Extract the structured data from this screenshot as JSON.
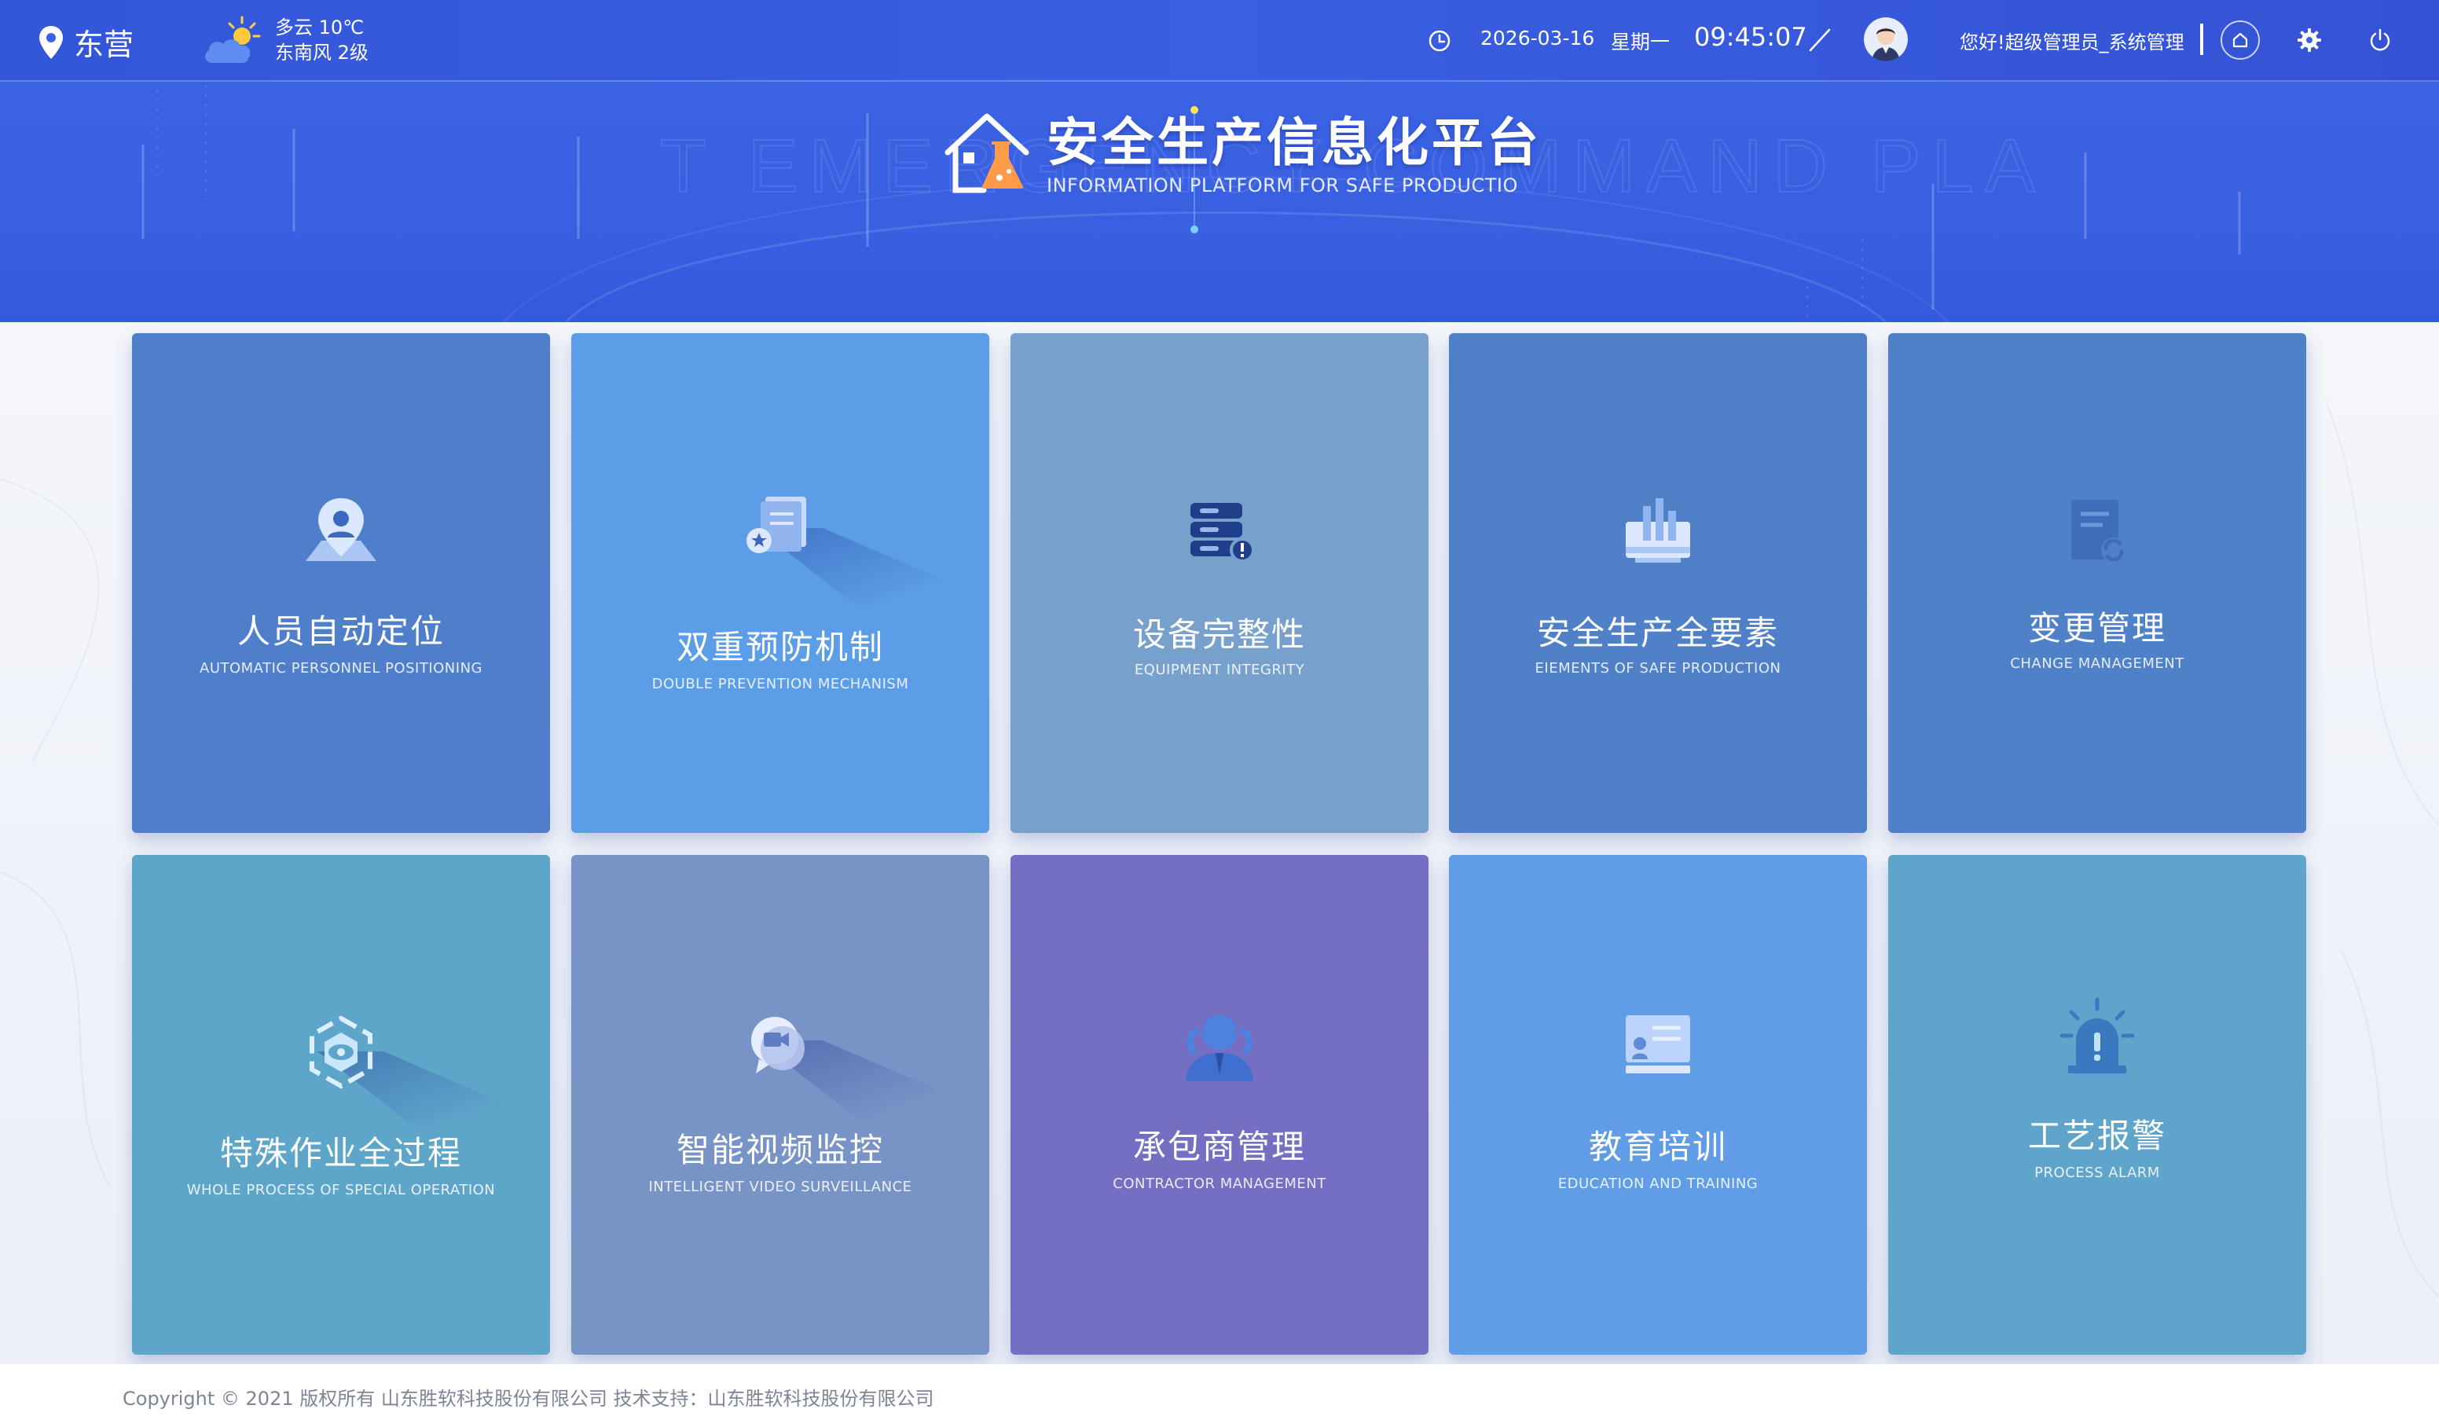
{
  "header": {
    "city": "东营",
    "weather": {
      "condition_temp": "多云 10℃",
      "wind": "东南风 2级"
    },
    "date": "2026-03-16",
    "weekday": "星期一",
    "time": "09:45:07",
    "greeting": "您好!超级管理员_系统管理",
    "icons": {
      "location": "location-pin-icon",
      "weather": "cloud-sun-icon",
      "clock": "clock-icon",
      "slash": "slash-icon",
      "home": "home-icon",
      "settings": "gear-icon",
      "power": "power-icon"
    }
  },
  "banner": {
    "title": "安全生产信息化平台",
    "subtitle": "INFORMATION PLATFORM FOR SAFE PRODUCTIO",
    "bg_watermark": "T EMERGENCY COMMAND PLA"
  },
  "modules": [
    {
      "title": "人员自动定位",
      "subtitle": "AUTOMATIC PERSONNEL POSITIONING",
      "icon": "map-pin-person-icon",
      "color": "#4f7fca"
    },
    {
      "title": "双重预防机制",
      "subtitle": "DOUBLE PREVENTION MECHANISM",
      "icon": "document-star-icon",
      "color": "#5b9de6"
    },
    {
      "title": "设备完整性",
      "subtitle": "EQUIPMENT INTEGRITY",
      "icon": "server-alert-icon",
      "color": "#78a0cc"
    },
    {
      "title": "安全生产全要素",
      "subtitle": "EIEMENTS OF SAFE PRODUCTION",
      "icon": "factory-chart-icon",
      "color": "#5080c8"
    },
    {
      "title": "变更管理",
      "subtitle": "CHANGE MANAGEMENT",
      "icon": "document-refresh-icon",
      "color": "#4f81c8"
    },
    {
      "title": "特殊作业全过程",
      "subtitle": "WHOLE PROCESS OF SPECIAL OPERATION",
      "icon": "hexagon-eye-icon",
      "color": "#5ea5ca"
    },
    {
      "title": "智能视频监控",
      "subtitle": "INTELLIGENT VIDEO SURVEILLANCE",
      "icon": "video-chat-icon",
      "color": "#7893c6"
    },
    {
      "title": "承包商管理",
      "subtitle": "CONTRACTOR MANAGEMENT",
      "icon": "person-tie-icon",
      "color": "#756fc4"
    },
    {
      "title": "教育培训",
      "subtitle": "EDUCATION AND TRAINING",
      "icon": "training-board-icon",
      "color": "#619de6"
    },
    {
      "title": "工艺报警",
      "subtitle": "PROCESS ALARM",
      "icon": "alarm-siren-icon",
      "color": "#5fa4ca"
    }
  ],
  "footer": {
    "copyright": "Copyright © 2021 版权所有 山东胜软科技股份有限公司 技术支持：山东胜软科技股份有限公司"
  }
}
